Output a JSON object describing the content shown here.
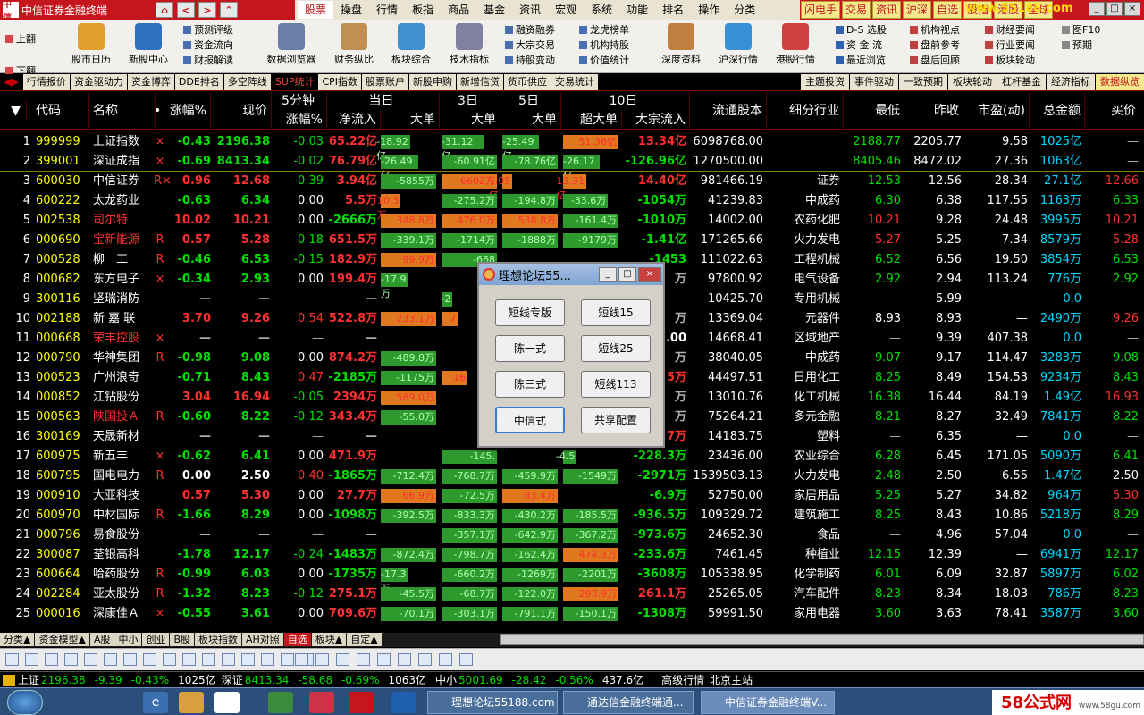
{
  "app": {
    "title": "中信证券金融终端",
    "logo": "中信"
  },
  "nav": {
    "home": "⌂",
    "back": "<",
    "forward": ">",
    "up": "⌃"
  },
  "topmenu": [
    "股票",
    "操盘",
    "行情",
    "板指",
    "商品",
    "基金",
    "资讯",
    "宏观",
    "系统",
    "功能",
    "排名",
    "操作",
    "分类"
  ],
  "quick": [
    "闪电手",
    "交易",
    "资讯",
    "沪深",
    "自选",
    "股指",
    "港股",
    "全球"
  ],
  "watermark": "www.55188.com",
  "winctrl": [
    "_",
    "□",
    "×"
  ],
  "toolbar": {
    "updown": [
      "上翻",
      "下翻"
    ],
    "big": [
      "股市日历",
      "新股中心",
      "数据浏览器",
      "财务纵比",
      "板块综合",
      "技术指标",
      "深度资料",
      "沪深行情",
      "港股行情"
    ],
    "small1": [
      "预测评级",
      "资金流向",
      "财报解读"
    ],
    "small2": [
      "融资融券",
      "大宗交易",
      "持股变动"
    ],
    "small3": [
      "龙虎榜单",
      "机构持股",
      "价值统计"
    ],
    "small4": [
      "D-S 选股",
      "资 金 流",
      "最近浏览"
    ],
    "small5": [
      "机构视点",
      "盘前参考",
      "盘后回顾"
    ],
    "small6": [
      "财经要闻",
      "行业要闻",
      "板块轮动"
    ],
    "small7": [
      "图F10",
      "预期"
    ]
  },
  "tabs": [
    "行情报价",
    "资金驱动力",
    "资金博弈",
    "DDE排名",
    "多空阵线",
    "SUP统计",
    "CPI指数",
    "股票账户",
    "新股申购",
    "新增信贷",
    "货币供应",
    "交易统计"
  ],
  "tabs_active": "SUP统计",
  "tabs_right": [
    "主题投资",
    "事件驱动",
    "一致预期",
    "板块轮动",
    "杠杆基金",
    "经济指标",
    "数据纵览"
  ],
  "headers": {
    "sort": "▼",
    "code": "代码",
    "name": "名称",
    "dot": "•",
    "pct": "涨幅%",
    "price": "现价",
    "g5": "5分钟",
    "g5sub": "涨幅%",
    "gday": "当日",
    "flow": "净流入",
    "big": "大单",
    "g3": "3日",
    "big3": "大单",
    "g5d": "5日",
    "big5": "大单",
    "g10": "10日",
    "super": "超大单",
    "block": "大宗流入",
    "float": "流通股本",
    "industry": "细分行业",
    "low": "最低",
    "prev": "昨收",
    "pe": "市盈(动)",
    "amount": "总金额",
    "bid": "买价"
  },
  "rows": [
    {
      "no": "1",
      "code": "999999",
      "name": "上证指数",
      "mark": "×",
      "pct": "-0.43",
      "price": "2196.38",
      "m5": "-0.03",
      "flow": "65.22亿",
      "b1": "-18.92亿",
      "b3": "-31.12亿",
      "b5": "-25.49亿",
      "sup": "51.36亿",
      "blk": "13.34亿",
      "float": "6098768.00",
      "ind": "",
      "low": "2188.77",
      "prev": "2205.77",
      "pe": "9.58",
      "amt": "1025亿",
      "bid": "—"
    },
    {
      "no": "2",
      "code": "399001",
      "name": "深证成指",
      "mark": "×",
      "pct": "-0.69",
      "price": "8413.34",
      "m5": "-0.02",
      "flow": "76.79亿",
      "b1": "-26.49亿",
      "b3": "-60.91亿",
      "b5": "-78.76亿",
      "sup": "-26.17亿",
      "blk": "-126.96亿",
      "float": "1270500.00",
      "ind": "",
      "low": "8405.46",
      "prev": "8472.02",
      "pe": "27.36",
      "amt": "1063亿",
      "bid": "—"
    },
    {
      "no": "3",
      "code": "600030",
      "name": "中信证券",
      "mark": "R×",
      "pct": "0.96",
      "price": "12.68",
      "m5": "-0.39",
      "flow": "3.94亿",
      "b1": "-5855万",
      "b3": "6602万",
      "b5": "1.05亿",
      "sup": "13.31亿",
      "blk": "14.40亿",
      "float": "981466.19",
      "ind": "证券",
      "low": "12.53",
      "prev": "12.56",
      "pe": "28.34",
      "amt": "27.1亿",
      "bid": "12.66"
    },
    {
      "no": "4",
      "code": "600222",
      "name": "太龙药业",
      "mark": "",
      "pct": "-0.63",
      "price": "6.34",
      "m5": "0.00",
      "flow": "5.5万",
      "b1": "10.3万",
      "b3": "-275.2万",
      "b5": "-194.8万",
      "sup": "-33.6万",
      "blk": "-1054万",
      "float": "41239.83",
      "ind": "中成药",
      "low": "6.30",
      "prev": "6.38",
      "pe": "117.55",
      "amt": "1163万",
      "bid": "6.33"
    },
    {
      "no": "5",
      "code": "002538",
      "name": "司尔特",
      "mark": "",
      "pct": "10.02",
      "price": "10.21",
      "m5": "0.00",
      "flow": "-2666万",
      "b1": "348.8万",
      "b3": "476.0万",
      "b5": "538.8万",
      "sup": "-161.4万",
      "blk": "-1010万",
      "float": "14002.00",
      "ind": "农药化肥",
      "low": "10.21",
      "prev": "9.28",
      "pe": "24.48",
      "amt": "3995万",
      "bid": "10.21"
    },
    {
      "no": "6",
      "code": "000690",
      "name": "宝新能源",
      "mark": "R",
      "pct": "0.57",
      "price": "5.28",
      "m5": "-0.18",
      "flow": "651.5万",
      "b1": "-339.1万",
      "b3": "-1714万",
      "b5": "-1888万",
      "sup": "-9179万",
      "blk": "-1.41亿",
      "float": "171265.66",
      "ind": "火力发电",
      "low": "5.27",
      "prev": "5.25",
      "pe": "7.34",
      "amt": "8579万",
      "bid": "5.28"
    },
    {
      "no": "7",
      "code": "000528",
      "name": "柳　工",
      "mark": "R",
      "pct": "-0.46",
      "price": "6.53",
      "m5": "-0.15",
      "flow": "182.9万",
      "b1": "99.9万",
      "b3": "-668",
      "b5": "",
      "sup": "",
      "blk": "-1453",
      "float": "111022.63",
      "ind": "工程机械",
      "low": "6.52",
      "prev": "6.56",
      "pe": "19.50",
      "amt": "3854万",
      "bid": "6.53"
    },
    {
      "no": "8",
      "code": "000682",
      "name": "东方电子",
      "mark": "×",
      "pct": "-0.34",
      "price": "2.93",
      "m5": "0.00",
      "flow": "199.4万",
      "b1": "-17.9万",
      "b3": "",
      "b5": "",
      "sup": "",
      "blk": "万",
      "float": "97800.92",
      "ind": "电气设备",
      "low": "2.92",
      "prev": "2.94",
      "pe": "113.24",
      "amt": "776万",
      "bid": "2.92"
    },
    {
      "no": "9",
      "code": "300116",
      "name": "坚瑞消防",
      "mark": "",
      "pct": "—",
      "price": "—",
      "m5": "—",
      "flow": "—",
      "b1": "",
      "b3": "-2",
      "b5": "",
      "sup": "",
      "blk": "",
      "float": "10425.70",
      "ind": "专用机械",
      "low": "",
      "prev": "5.99",
      "pe": "—",
      "amt": "0.0",
      "bid": "—"
    },
    {
      "no": "10",
      "code": "002188",
      "name": "新 嘉 联",
      "mark": "",
      "pct": "3.70",
      "price": "9.26",
      "m5": "0.54",
      "flow": "522.8万",
      "b1": "233.1万",
      "b3": "7",
      "b5": "",
      "sup": "",
      "blk": "万",
      "float": "13369.04",
      "ind": "元器件",
      "low": "8.93",
      "prev": "8.93",
      "pe": "—",
      "amt": "2490万",
      "bid": "9.26"
    },
    {
      "no": "11",
      "code": "000668",
      "name": "荣丰控股",
      "mark": "×",
      "pct": "—",
      "price": "—",
      "m5": "—",
      "flow": "—",
      "b1": "",
      "b3": "",
      "b5": "",
      "sup": "",
      "blk": ".00",
      "float": "14668.41",
      "ind": "区域地产",
      "low": "—",
      "prev": "9.39",
      "pe": "407.38",
      "amt": "0.0",
      "bid": "—"
    },
    {
      "no": "12",
      "code": "000790",
      "name": "华神集团",
      "mark": "R",
      "pct": "-0.98",
      "price": "9.08",
      "m5": "0.00",
      "flow": "874.2万",
      "b1": "-489.8万",
      "b3": "",
      "b5": "",
      "sup": "",
      "blk": "万",
      "float": "38040.05",
      "ind": "中成药",
      "low": "9.07",
      "prev": "9.17",
      "pe": "114.47",
      "amt": "3283万",
      "bid": "9.08"
    },
    {
      "no": "13",
      "code": "000523",
      "name": "广州浪奇",
      "mark": "",
      "pct": "-0.71",
      "price": "8.43",
      "m5": "0.47",
      "flow": "-2185万",
      "b1": "-1175万",
      "b3": "16",
      "b5": "",
      "sup": "",
      "blk": "5万",
      "float": "44497.51",
      "ind": "日用化工",
      "low": "8.25",
      "prev": "8.49",
      "pe": "154.53",
      "amt": "9234万",
      "bid": "8.43"
    },
    {
      "no": "14",
      "code": "000852",
      "name": "江钻股份",
      "mark": "",
      "pct": "3.04",
      "price": "16.94",
      "m5": "-0.05",
      "flow": "2394万",
      "b1": "589.0万",
      "b3": "",
      "b5": "",
      "sup": "",
      "blk": "万",
      "float": "13010.76",
      "ind": "化工机械",
      "low": "16.38",
      "prev": "16.44",
      "pe": "84.19",
      "amt": "1.49亿",
      "bid": "16.93"
    },
    {
      "no": "15",
      "code": "000563",
      "name": "陕国投Ａ",
      "mark": "R",
      "pct": "-0.60",
      "price": "8.22",
      "m5": "-0.12",
      "flow": "343.4万",
      "b1": "-55.0万",
      "b3": "",
      "b5": "",
      "sup": "",
      "blk": "万",
      "float": "75264.21",
      "ind": "多元金融",
      "low": "8.21",
      "prev": "8.27",
      "pe": "32.49",
      "amt": "7841万",
      "bid": "8.22"
    },
    {
      "no": "16",
      "code": "300169",
      "name": "天晟新材",
      "mark": "",
      "pct": "—",
      "price": "—",
      "m5": "—",
      "flow": "—",
      "b1": "",
      "b3": "",
      "b5": "",
      "sup": "",
      "blk": "7万",
      "float": "14183.75",
      "ind": "塑料",
      "low": "—",
      "prev": "6.35",
      "pe": "—",
      "amt": "0.0",
      "bid": "—"
    },
    {
      "no": "17",
      "code": "600975",
      "name": "新五丰",
      "mark": "×",
      "pct": "-0.62",
      "price": "6.41",
      "m5": "0.00",
      "flow": "471.9万",
      "b1": "",
      "b3": "-145.",
      "b5": "",
      "sup": "-4.5",
      "blk": "-228.3万",
      "float": "23436.00",
      "ind": "农业综合",
      "low": "6.28",
      "prev": "6.45",
      "pe": "171.05",
      "amt": "5090万",
      "bid": "6.41"
    },
    {
      "no": "18",
      "code": "600795",
      "name": "国电电力",
      "mark": "R",
      "pct": "0.00",
      "price": "2.50",
      "m5": "0.40",
      "flow": "-1865万",
      "b1": "-712.4万",
      "b3": "-768.7万",
      "b5": "-459.9万",
      "sup": "-1549万",
      "blk": "-2971万",
      "float": "1539503.13",
      "ind": "火力发电",
      "low": "2.48",
      "prev": "2.50",
      "pe": "6.55",
      "amt": "1.47亿",
      "bid": "2.50"
    },
    {
      "no": "19",
      "code": "000910",
      "name": "大亚科技",
      "mark": "",
      "pct": "0.57",
      "price": "5.30",
      "m5": "0.00",
      "flow": "27.7万",
      "b1": "66.9万",
      "b3": "-72.5万",
      "b5": "83.4万",
      "sup": "",
      "blk": "-6.9万",
      "float": "52750.00",
      "ind": "家居用品",
      "low": "5.25",
      "prev": "5.27",
      "pe": "34.82",
      "amt": "964万",
      "bid": "5.30"
    },
    {
      "no": "20",
      "code": "600970",
      "name": "中材国际",
      "mark": "R",
      "pct": "-1.66",
      "price": "8.29",
      "m5": "0.00",
      "flow": "-1098万",
      "b1": "-392.5万",
      "b3": "-833.3万",
      "b5": "-430.2万",
      "sup": "-185.5万",
      "blk": "-936.5万",
      "float": "109329.72",
      "ind": "建筑施工",
      "low": "8.25",
      "prev": "8.43",
      "pe": "10.86",
      "amt": "5218万",
      "bid": "8.29"
    },
    {
      "no": "21",
      "code": "000796",
      "name": "易食股份",
      "mark": "",
      "pct": "—",
      "price": "—",
      "m5": "—",
      "flow": "—",
      "b1": "",
      "b3": "-357.1万",
      "b5": "-642.9万",
      "sup": "-367.2万",
      "blk": "-973.6万",
      "float": "24652.30",
      "ind": "食品",
      "low": "—",
      "prev": "4.96",
      "pe": "57.04",
      "amt": "0.0",
      "bid": "—"
    },
    {
      "no": "22",
      "code": "300087",
      "name": "荃银高科",
      "mark": "",
      "pct": "-1.78",
      "price": "12.17",
      "m5": "-0.24",
      "flow": "-1483万",
      "b1": "-872.4万",
      "b3": "-798.7万",
      "b5": "-162.4万",
      "sup": "474.3万",
      "blk": "-233.6万",
      "float": "7461.45",
      "ind": "种植业",
      "low": "12.15",
      "prev": "12.39",
      "pe": "—",
      "amt": "6941万",
      "bid": "12.17"
    },
    {
      "no": "23",
      "code": "600664",
      "name": "哈药股份",
      "mark": "R",
      "pct": "-0.99",
      "price": "6.03",
      "m5": "0.00",
      "flow": "-1735万",
      "b1": "-17.3万",
      "b3": "-660.2万",
      "b5": "-1269万",
      "sup": "-2201万",
      "blk": "-3608万",
      "float": "105338.95",
      "ind": "化学制药",
      "low": "6.01",
      "prev": "6.09",
      "pe": "32.87",
      "amt": "5897万",
      "bid": "6.02"
    },
    {
      "no": "24",
      "code": "002284",
      "name": "亚太股份",
      "mark": "R",
      "pct": "-1.32",
      "price": "8.23",
      "m5": "-0.12",
      "flow": "275.1万",
      "b1": "-45.5万",
      "b3": "-68.7万",
      "b5": "-122.0万",
      "sup": "293.9万",
      "blk": "261.1万",
      "float": "25265.05",
      "ind": "汽车配件",
      "low": "8.23",
      "prev": "8.34",
      "pe": "18.03",
      "amt": "786万",
      "bid": "8.23"
    },
    {
      "no": "25",
      "code": "000016",
      "name": "深康佳Ａ",
      "mark": "×",
      "pct": "-0.55",
      "price": "3.61",
      "m5": "0.00",
      "flow": "709.6万",
      "b1": "-70.1万",
      "b3": "-303.1万",
      "b5": "-791.1万",
      "sup": "-150.1万",
      "blk": "-1308万",
      "float": "59991.50",
      "ind": "家用电器",
      "low": "3.60",
      "prev": "3.63",
      "pe": "78.41",
      "amt": "3587万",
      "bid": "3.60"
    }
  ],
  "bottomtabs": [
    "分类▲",
    "资金模型▲",
    "A股",
    "中小",
    "创业",
    "B股",
    "板块指数",
    "AH对照",
    "自选",
    "板块▲",
    "自定▲"
  ],
  "bottomtabs_active": "自选",
  "status": {
    "sh_label": "上证",
    "sh_val": "2196.38",
    "sh_chg": "-9.39",
    "sh_pct": "-0.43%",
    "sh_amt": "1025亿",
    "sz_label": "深证",
    "sz_val": "8413.34",
    "sz_chg": "-58.68",
    "sz_pct": "-0.69%",
    "sz_amt": "1063亿",
    "zx_label": "中小",
    "zx_val": "5001.69",
    "zx_chg": "-28.42",
    "zx_pct": "-0.56%",
    "zx_amt": "437.6亿",
    "site": "高级行情_北京主站"
  },
  "taskbar": {
    "items": [
      "理想论坛55188.com",
      "通达信金融终端通...",
      "中信证券金融终端V..."
    ],
    "watermark": "58公式网",
    "watermark_sub": "www.58gu.com"
  },
  "popup": {
    "title": "理想论坛55...",
    "buttons": [
      "短线专版",
      "短线15",
      "陈一式",
      "短线25",
      "陈三式",
      "短线113",
      "中信式",
      "共享配置"
    ]
  }
}
